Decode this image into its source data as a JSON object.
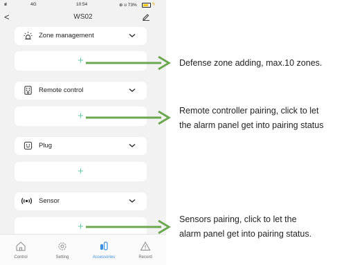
{
  "statusbar": {
    "signal": "ıııl",
    "network": "4G",
    "time": "10:54",
    "battery_text": "⊕ ʊ 73%",
    "battery_level": 0.73
  },
  "header": {
    "back_icon": "chevron-left-icon",
    "title": "WS02",
    "edit_icon": "pencil-icon"
  },
  "sections": [
    {
      "label": "Zone management",
      "icon": "alarm-siren-icon",
      "add_symbol": "+"
    },
    {
      "label": "Remote control",
      "icon": "remote-control-icon",
      "add_symbol": "+"
    },
    {
      "label": "Plug",
      "icon": "plug-icon",
      "add_symbol": "+"
    },
    {
      "label": "Sensor",
      "icon": "sensor-icon",
      "add_symbol": "+"
    }
  ],
  "tabbar": {
    "tabs": [
      {
        "label": "Control",
        "icon": "home-icon",
        "active": false
      },
      {
        "label": "Setting",
        "icon": "gear-icon",
        "active": false
      },
      {
        "label": "Accessories",
        "icon": "accessories-icon",
        "active": true
      },
      {
        "label": "Record",
        "icon": "warning-icon",
        "active": false
      }
    ]
  },
  "annotations": {
    "zone_add": "Defense zone adding, max.10 zones.",
    "remote_pair_line1": "Remote controller pairing, click to let",
    "remote_pair_line2": "the alarm panel get into pairing status",
    "sensor_pair_line1": "Sensors pairing, click to let the",
    "sensor_pair_line2": "alarm panel get into pairing status."
  },
  "colors": {
    "accent_green": "#69c8a8",
    "arrow_green": "#6aa84f",
    "active_tab": "#3b8fe0",
    "background": "#f2f2f2"
  }
}
